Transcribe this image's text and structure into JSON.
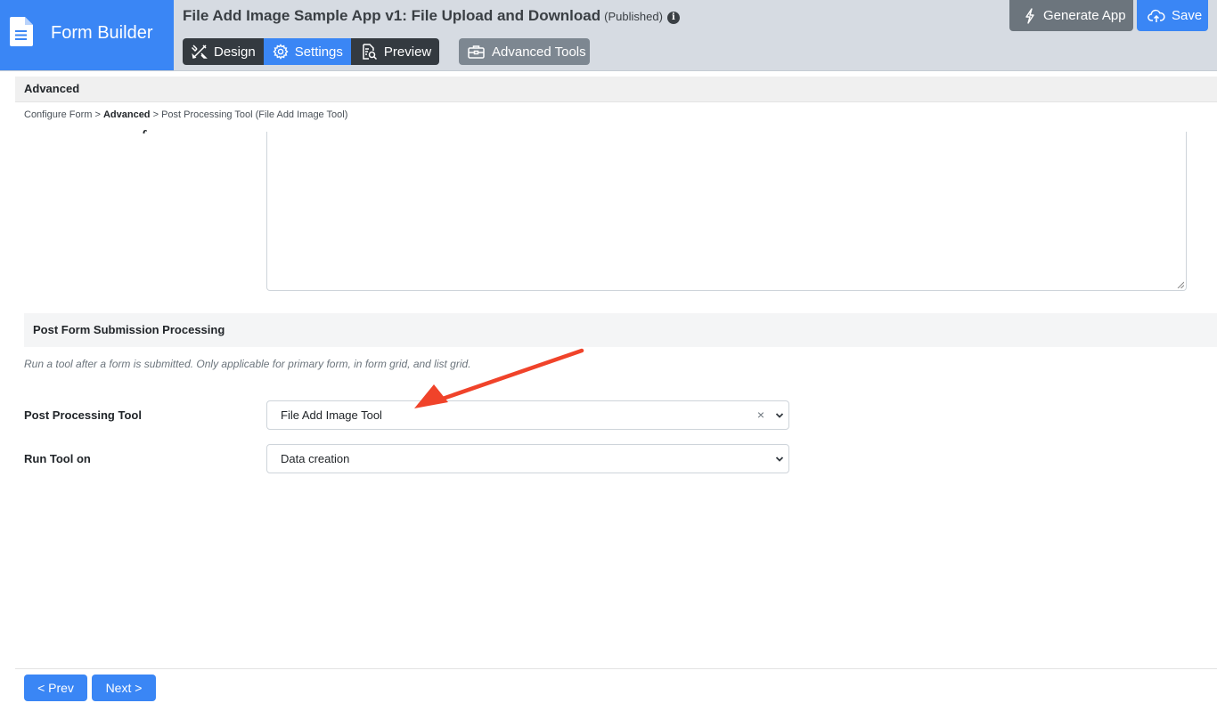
{
  "brand": {
    "title": "Form Builder",
    "icon": "document-icon"
  },
  "app": {
    "title": "File Add Image Sample App v1: File Upload and Download",
    "status": "(Published)",
    "info_icon": "i"
  },
  "tabs": [
    {
      "label": "Design",
      "icon": "design-tools-icon"
    },
    {
      "label": "Settings",
      "icon": "gear-icon",
      "active": true
    },
    {
      "label": "Preview",
      "icon": "preview-icon"
    }
  ],
  "advanced_tools": {
    "label": "Advanced Tools",
    "icon": "toolbox-icon"
  },
  "actions": {
    "generate_label": "Generate App",
    "save_label": "Save"
  },
  "section": {
    "title": "Advanced"
  },
  "breadcrumb": {
    "part1": "Configure Form > ",
    "part2": "Advanced",
    "part3": " > Post Processing Tool (File Add Image Tool)"
  },
  "post_processing": {
    "heading": "Post Form Submission Processing",
    "help": "Run a tool after a form is submitted. Only applicable for primary form, in form grid, and list grid.",
    "tool_label": "Post Processing Tool",
    "tool_value": "File Add Image Tool",
    "clear_symbol": "×",
    "run_label": "Run Tool on",
    "run_value": "Data creation"
  },
  "footer": {
    "prev_label": "< Prev",
    "next_label": "Next >"
  },
  "colors": {
    "primary": "#3a86f5",
    "dark": "#343a40",
    "secondary": "#6c757d",
    "annotation_arrow": "#f0432a"
  }
}
